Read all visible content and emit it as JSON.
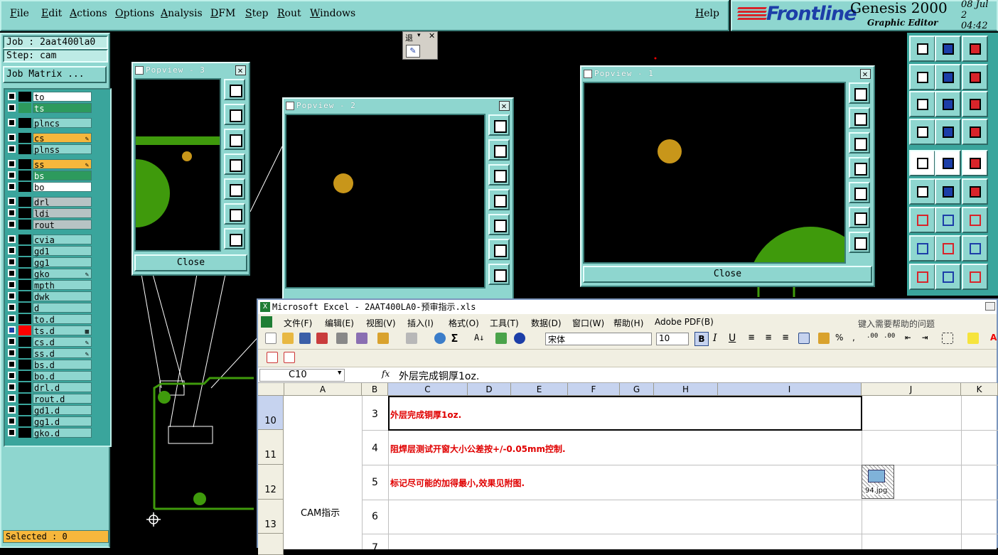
{
  "menu": [
    "File",
    "Edit",
    "Actions",
    "Options",
    "Analysis",
    "DFM",
    "Step",
    "Rout",
    "Windows"
  ],
  "help": "Help",
  "brand": {
    "logo": "Frontline",
    "product": "Genesis 2000",
    "subtitle": "Graphic Editor",
    "date": "08 Jul 2",
    "time": "04:42"
  },
  "job": {
    "job_label": "Job : 2aat400la0",
    "step_label": "Step: cam",
    "matrix_button": "Job Matrix ..."
  },
  "layers": [
    {
      "name": "to",
      "style": "w",
      "sel": false,
      "color": "#000000"
    },
    {
      "name": "ts",
      "style": "g",
      "sel": false,
      "color": "#2d9a5d"
    },
    {
      "name": "plncs",
      "style": "",
      "sel": false,
      "color": "#000000"
    },
    {
      "name": "cs",
      "style": "o",
      "sel": false,
      "color": "#000000",
      "icon": "pencil-icon"
    },
    {
      "name": "plnss",
      "style": "",
      "sel": false,
      "color": "#000000"
    },
    {
      "name": "ss",
      "style": "o",
      "sel": false,
      "color": "#000000",
      "icon": "pencil-icon"
    },
    {
      "name": "bs",
      "style": "g",
      "sel": false,
      "color": "#000000"
    },
    {
      "name": "bo",
      "style": "w",
      "sel": false,
      "color": "#000000"
    },
    {
      "name": "drl",
      "style": "gr",
      "sel": false,
      "color": "#000000"
    },
    {
      "name": "ldi",
      "style": "gr",
      "sel": false,
      "color": "#000000"
    },
    {
      "name": "rout",
      "style": "gr",
      "sel": false,
      "color": "#000000"
    },
    {
      "name": "cvia",
      "style": "",
      "sel": false,
      "color": "#000000"
    },
    {
      "name": "gd1",
      "style": "",
      "sel": false,
      "color": "#000000"
    },
    {
      "name": "gg1",
      "style": "",
      "sel": false,
      "color": "#000000"
    },
    {
      "name": "gko",
      "style": "",
      "sel": false,
      "color": "#000000",
      "icon": "pencil-icon"
    },
    {
      "name": "mpth",
      "style": "",
      "sel": false,
      "color": "#000000"
    },
    {
      "name": "dwk",
      "style": "",
      "sel": false,
      "color": "#000000"
    },
    {
      "name": "d",
      "style": "",
      "sel": false,
      "color": "#000000"
    },
    {
      "name": "to.d",
      "style": "",
      "sel": false,
      "color": "#000000"
    },
    {
      "name": "ts.d",
      "style": "",
      "sel": true,
      "color": "#ff0000",
      "icon": "grid-icon"
    },
    {
      "name": "cs.d",
      "style": "",
      "sel": false,
      "color": "#000000",
      "icon": "pencil-icon"
    },
    {
      "name": "ss.d",
      "style": "",
      "sel": false,
      "color": "#000000",
      "icon": "pencil-icon"
    },
    {
      "name": "bs.d",
      "style": "",
      "sel": false,
      "color": "#000000"
    },
    {
      "name": "bo.d",
      "style": "",
      "sel": false,
      "color": "#000000"
    },
    {
      "name": "drl.d",
      "style": "",
      "sel": false,
      "color": "#000000"
    },
    {
      "name": "rout.d",
      "style": "",
      "sel": false,
      "color": "#000000"
    },
    {
      "name": "gd1.d",
      "style": "",
      "sel": false,
      "color": "#000000"
    },
    {
      "name": "gg1.d",
      "style": "",
      "sel": false,
      "color": "#000000"
    },
    {
      "name": "gko.d",
      "style": "",
      "sel": false,
      "color": "#000000"
    }
  ],
  "selected": "Selected : 0",
  "popviews": {
    "p3": "Popview - 3",
    "p2": "Popview - 2",
    "p1": "Popview - 1",
    "close": "Close"
  },
  "mini_toolbar": {
    "label": "退"
  },
  "colors": {
    "cam_bg": "#8ed6cf",
    "copper": "#3f9a0c",
    "pad": "#c8961a",
    "excel_red": "#e00000"
  },
  "excel": {
    "title": "Microsoft Excel - 2AAT400LA0-预审指示.xls",
    "menu": [
      "文件(F)",
      "编辑(E)",
      "视图(V)",
      "插入(I)",
      "格式(O)",
      "工具(T)",
      "数据(D)",
      "窗口(W)",
      "帮助(H)",
      "Adobe PDF(B)"
    ],
    "help_search": "键入需要帮助的问题",
    "font_name": "宋体",
    "font_size": "10",
    "name_box": "C10",
    "formula": "外层完成铜厚1oz.",
    "columns": [
      "A",
      "B",
      "C",
      "D",
      "E",
      "F",
      "G",
      "H",
      "I",
      "J",
      "K"
    ],
    "rows": [
      {
        "num": "10",
        "seq": "3",
        "text": "外层完成铜厚1oz."
      },
      {
        "num": "11",
        "seq": "4",
        "text": "阻焊层测试开窗大小公差按+/-0.05mm控制."
      },
      {
        "num": "12",
        "seq": "5",
        "text": "标记尽可能的加得最小,效果见附图."
      },
      {
        "num": "13",
        "seq": "6",
        "text": ""
      },
      {
        "num": "",
        "seq": "7",
        "text": ""
      }
    ],
    "merged_label": "CAM指示",
    "attachment": "94.jpg"
  }
}
